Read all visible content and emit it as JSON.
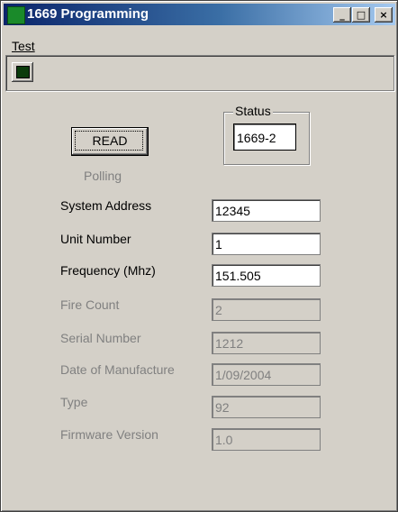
{
  "window": {
    "title": "1669 Programming",
    "controls": {
      "minimize": "_",
      "maximize": "□",
      "close": "×"
    }
  },
  "menubar": {
    "items": [
      "Test"
    ]
  },
  "toolbar": {
    "buttons": [
      {
        "icon": "chip-icon"
      }
    ]
  },
  "main": {
    "read_button": "READ",
    "polling_label": "Polling",
    "status": {
      "caption": "Status",
      "value": "1669-2"
    },
    "fields": [
      {
        "label": "System Address",
        "value": "12345",
        "enabled": true
      },
      {
        "label": "Unit Number",
        "value": "1",
        "enabled": true
      },
      {
        "label": "Frequency (Mhz)",
        "value": "151.505",
        "enabled": true
      },
      {
        "label": "Fire Count",
        "value": "2",
        "enabled": false
      },
      {
        "label": "Serial Number",
        "value": "1212",
        "enabled": false
      },
      {
        "label": "Date of Manufacture",
        "value": "1/09/2004",
        "enabled": false
      },
      {
        "label": "Type",
        "value": "92",
        "enabled": false
      },
      {
        "label": "Firmware Version",
        "value": "1.0",
        "enabled": false
      }
    ]
  },
  "colors": {
    "titlebar_start": "#0a246a",
    "titlebar_end": "#a6caf0",
    "disabled_text": "#808080"
  }
}
